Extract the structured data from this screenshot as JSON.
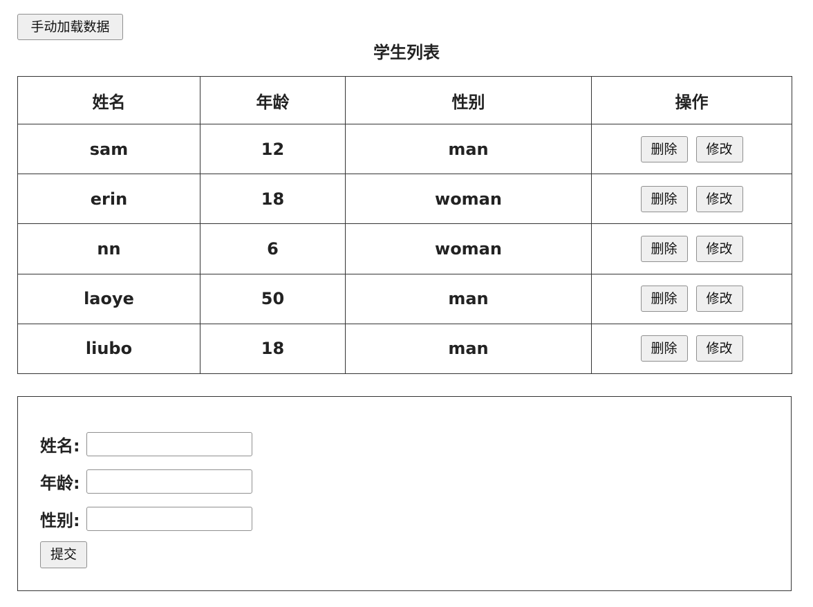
{
  "load_button": "手动加载数据",
  "title": "学生列表",
  "table": {
    "headers": [
      "姓名",
      "年龄",
      "性别",
      "操作"
    ],
    "rows": [
      {
        "name": "sam",
        "age": "12",
        "gender": "man"
      },
      {
        "name": "erin",
        "age": "18",
        "gender": "woman"
      },
      {
        "name": "nn",
        "age": "6",
        "gender": "woman"
      },
      {
        "name": "laoye",
        "age": "50",
        "gender": "man"
      },
      {
        "name": "liubo",
        "age": "18",
        "gender": "man"
      }
    ],
    "delete_label": "删除",
    "edit_label": "修改"
  },
  "form": {
    "name_label": "姓名:",
    "name_value": "",
    "age_label": "年龄:",
    "age_value": "",
    "gender_label": "性别:",
    "gender_value": "",
    "submit_label": "提交"
  }
}
